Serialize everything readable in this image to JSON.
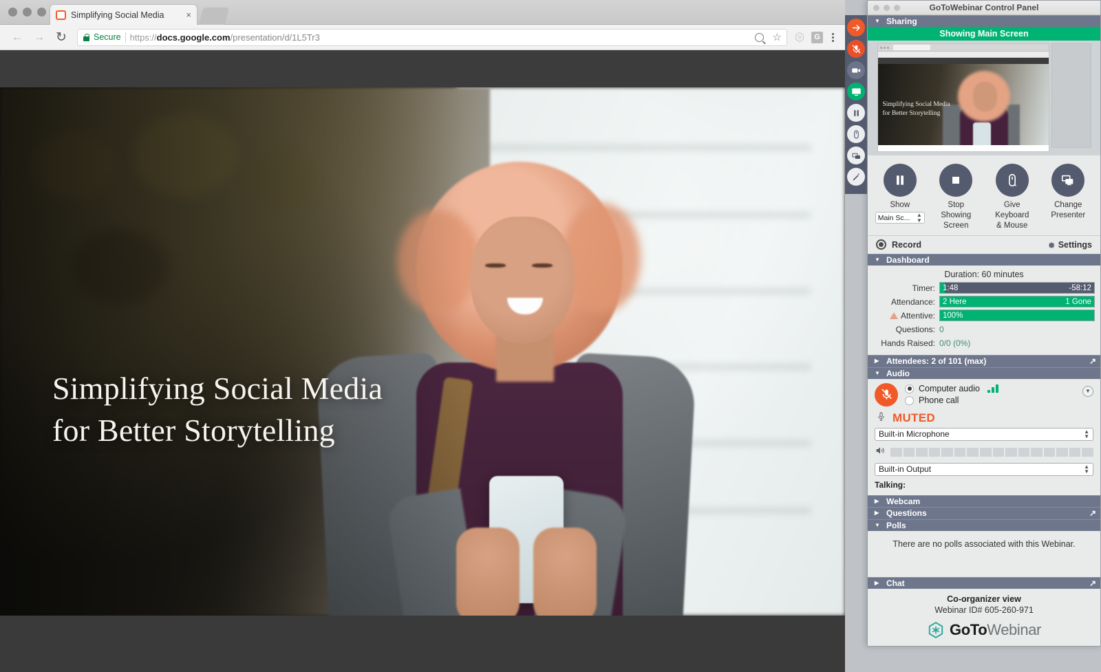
{
  "browser": {
    "tab": {
      "title": "Simplifying Social Media",
      "close": "×",
      "favicon_name": "slides-favicon"
    },
    "nav": {
      "back": "←",
      "forward": "→",
      "reload": "↻"
    },
    "omnibox": {
      "secure_label": "Secure",
      "scheme": "https://",
      "host": "docs.google.com",
      "path": "/presentation/d/1L5Tr3",
      "full_url": "https://docs.google.com/presentation/d/1L5Tr3",
      "search_icon": "magnifier-icon",
      "star_icon": "☆"
    },
    "extensions": {
      "hex_icon": "hexagon-extension-icon",
      "g_icon": "G",
      "menu_icon": "kebab-menu-icon"
    }
  },
  "slide": {
    "title_line1": "Simplifying Social Media",
    "title_line2": "for Better Storytelling"
  },
  "gtw": {
    "window_title": "GoToWebinar Control Panel",
    "rail": [
      {
        "name": "arrow-collapse-icon",
        "glyph": "→",
        "style": "orange"
      },
      {
        "name": "microphone-muted-icon",
        "glyph": "Ø",
        "style": "red"
      },
      {
        "name": "webcam-icon",
        "glyph": "▭",
        "style": "dark"
      },
      {
        "name": "screen-share-icon",
        "glyph": "▣",
        "style": "green"
      },
      {
        "name": "pause-icon",
        "glyph": "‖",
        "style": "light"
      },
      {
        "name": "mouse-icon",
        "glyph": "○",
        "style": "light"
      },
      {
        "name": "change-presenter-icon",
        "glyph": "▭",
        "style": "light"
      },
      {
        "name": "pencil-icon",
        "glyph": "✎",
        "style": "light"
      }
    ],
    "sections": {
      "sharing": "Sharing",
      "dashboard": "Dashboard",
      "attendees": "Attendees: 2 of 101 (max)",
      "audio": "Audio",
      "webcam": "Webcam",
      "questions": "Questions",
      "polls": "Polls",
      "chat": "Chat"
    },
    "sharing": {
      "status_bar": "Showing Main Screen",
      "preview_title_line1": "Simplifying Social Media",
      "preview_title_line2": "for Better Storytelling"
    },
    "controls": [
      {
        "label": "Show",
        "icon": "pause-icon",
        "has_select": true,
        "select_value": "Main Sc..."
      },
      {
        "label": "Stop\nShowing\nScreen",
        "icon": "stop-icon",
        "has_select": false
      },
      {
        "label": "Give\nKeyboard\n& Mouse",
        "icon": "mouse-icon",
        "has_select": false
      },
      {
        "label": "Change\nPresenter",
        "icon": "monitors-icon",
        "has_select": false
      }
    ],
    "record": {
      "label": "Record",
      "settings_label": "Settings"
    },
    "dashboard": {
      "duration": "Duration: 60 minutes",
      "timer_label": "Timer:",
      "timer_elapsed": "1:48",
      "timer_remaining": "-58:12",
      "attendance_label": "Attendance:",
      "attendance_here": "2 Here",
      "attendance_gone": "1 Gone",
      "attentive_label": "Attentive:",
      "attentive_value": "100%",
      "questions_label": "Questions:",
      "questions_value": "0",
      "hands_label": "Hands Raised:",
      "hands_value": "0/0 (0%)"
    },
    "audio": {
      "computer_audio": "Computer audio",
      "phone_call": "Phone call",
      "selected": "computer_audio",
      "muted_label": "MUTED",
      "mic_device": "Built-in Microphone",
      "output_device": "Built-in Output",
      "talking_label": "Talking:"
    },
    "polls": {
      "empty_message": "There are no polls associated with this Webinar."
    },
    "footer": {
      "co_organizer": "Co-organizer view",
      "webinar_id": "Webinar ID# 605-260-971",
      "logo_bold": "GoTo",
      "logo_light": "Webinar"
    }
  },
  "colors": {
    "green": "#00b373",
    "orange": "#f05a28",
    "section_header": "#6e768c",
    "dark_slate": "#545b6e",
    "teal": "#2fa89b"
  }
}
